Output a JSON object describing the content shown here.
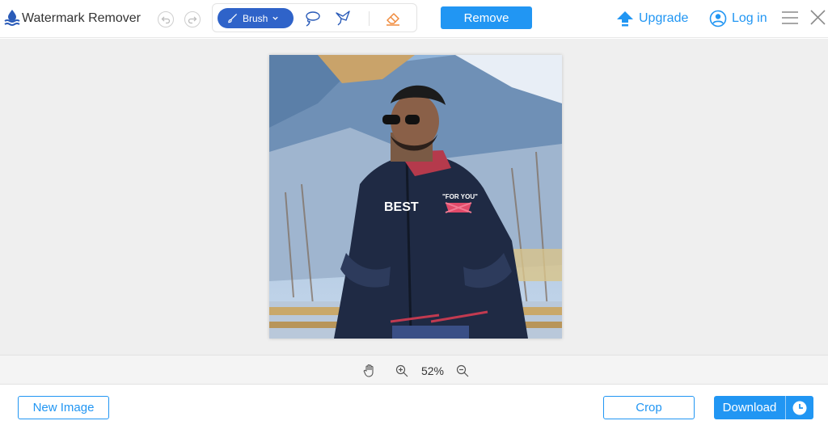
{
  "app": {
    "title": "Watermark Remover"
  },
  "colors": {
    "accent": "#2196f3",
    "brush_active": "#2f63c9",
    "canvas_bg": "#efefef",
    "eraser": "#f08a3c"
  },
  "header": {
    "undo_icon": "undo-icon",
    "redo_icon": "redo-icon",
    "tools": {
      "brush_label": "Brush",
      "brush_icon": "brush-icon",
      "lasso_icon": "lasso-icon",
      "polygonal_lasso_icon": "polygonal-lasso-icon",
      "eraser_icon": "eraser-icon"
    },
    "remove_label": "Remove",
    "upgrade_label": "Upgrade",
    "login_label": "Log in",
    "menu_icon": "hamburger-menu-icon",
    "close_icon": "close-icon"
  },
  "canvas": {
    "image_name": "preview-photo"
  },
  "zoom": {
    "value": "52%",
    "hand_icon": "hand-icon",
    "zoom_in_icon": "zoom-in-icon",
    "zoom_out_icon": "zoom-out-icon"
  },
  "footer": {
    "new_image_label": "New Image",
    "crop_label": "Crop",
    "download_label": "Download",
    "history_icon": "clock-icon"
  }
}
